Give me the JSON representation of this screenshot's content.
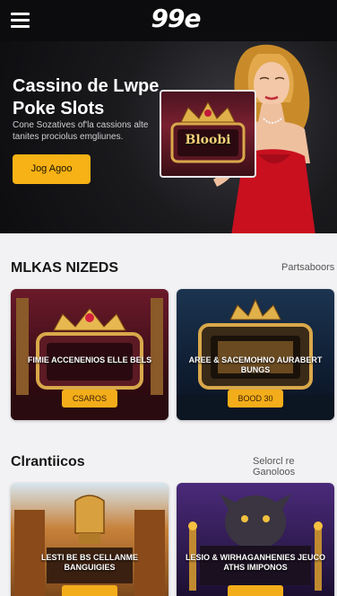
{
  "header": {
    "logo_text": "99e"
  },
  "hero": {
    "title": "Cassino de Lwpe Poke Slots",
    "subtitle": "Cone Sozatives of'la cassions alte tanites prociolus emgliunes.",
    "cta_label": "Jog Agoo",
    "card_title": "Bloobi"
  },
  "section1": {
    "title": "MLKAS NIZEDS",
    "link": "Partsaboors",
    "tiles": [
      {
        "label": "FIMIE ACCENENIOS ELLE BELS",
        "button": "CSAROS"
      },
      {
        "label": "AREE & SACEMOHNO AURABERT BUNGS",
        "button": "BOOD 30"
      }
    ]
  },
  "section2": {
    "title": "Clrantiicos",
    "link": "Selorcl re Ganoloos",
    "tiles": [
      {
        "label": "LESTI BE BS CELLANME BANGUIGIES"
      },
      {
        "label": "LESIO & WIRHAGANHENIES JEUCO ATHS IMIPONOS"
      }
    ]
  },
  "colors": {
    "accent": "#f7b215",
    "header_bg": "#0c0c0e"
  }
}
